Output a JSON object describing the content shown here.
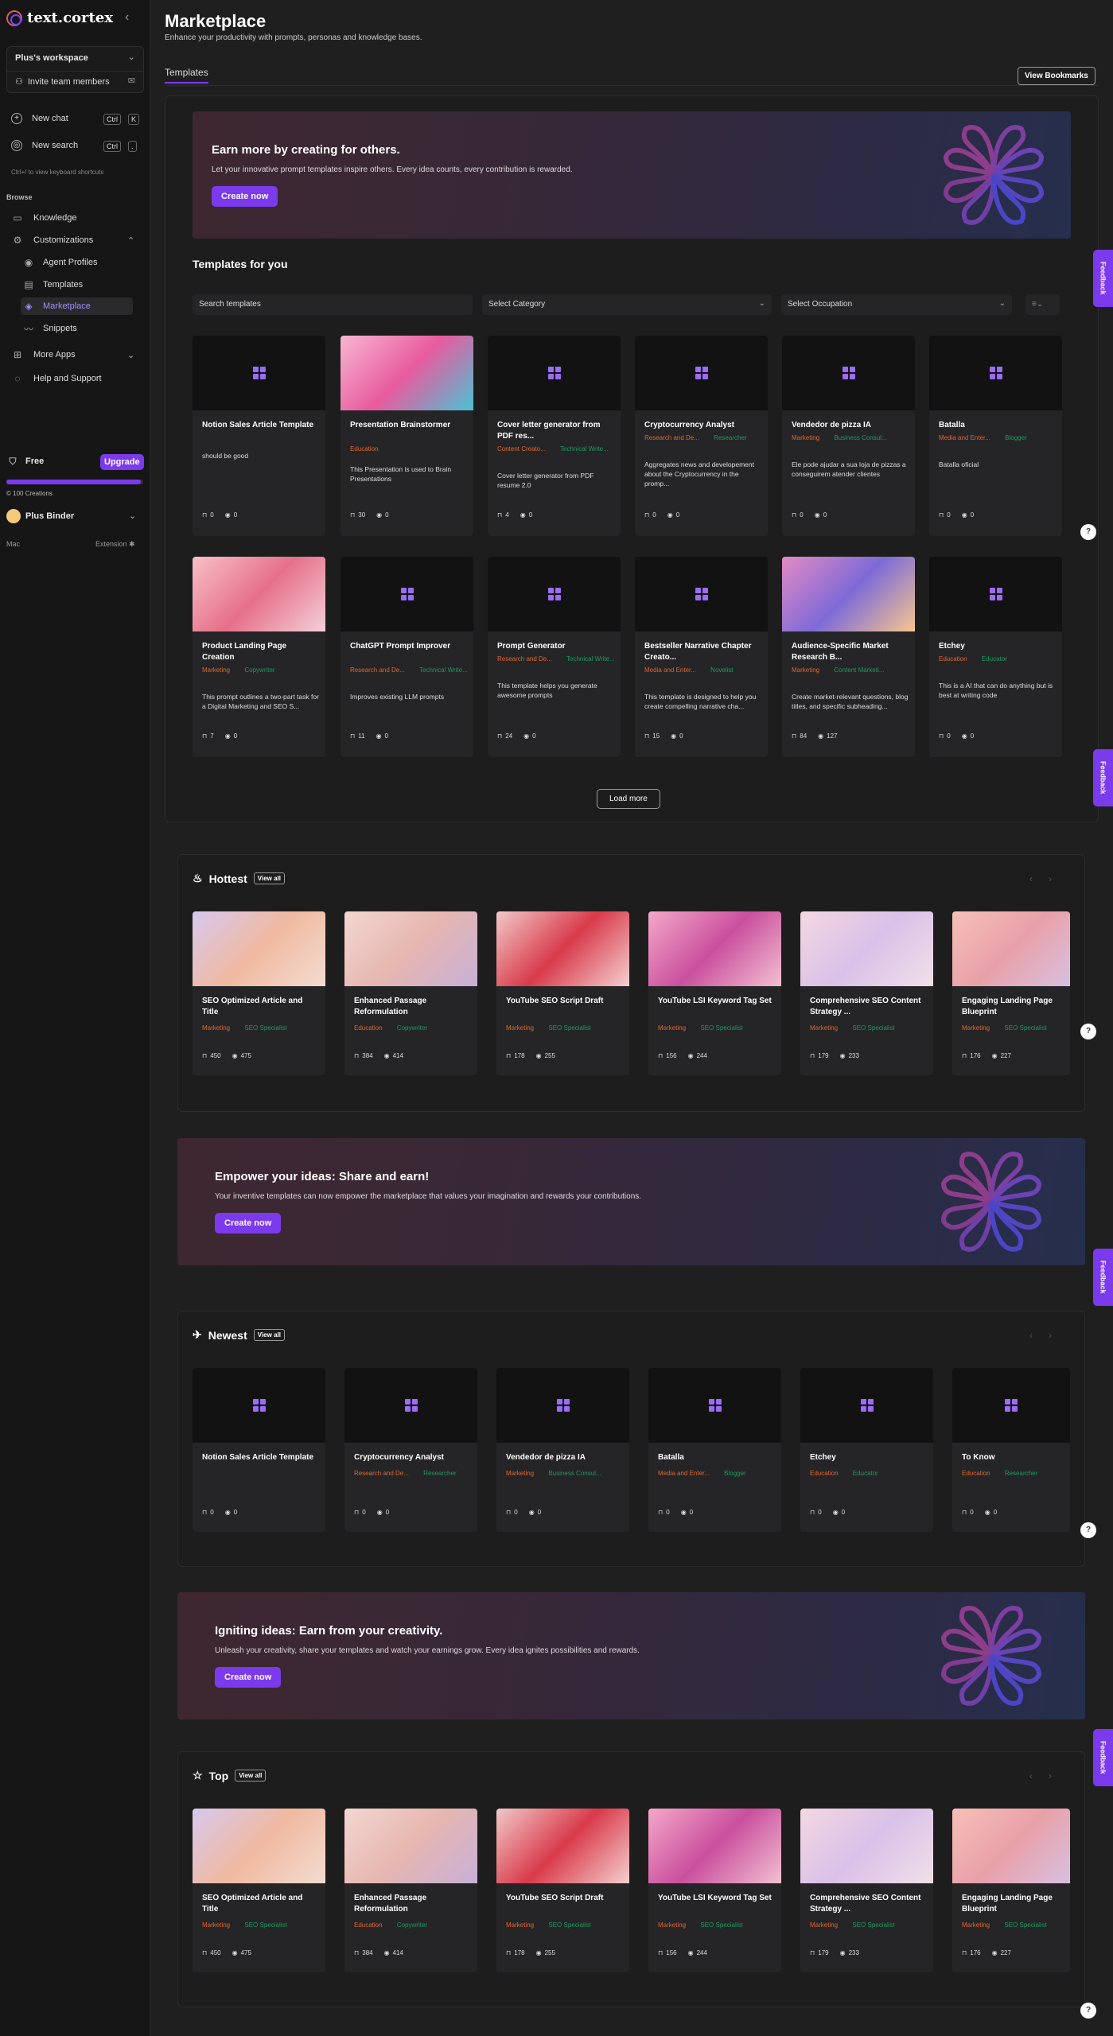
{
  "sidebar": {
    "logo": "text.cortex",
    "workspace": "Plus's workspace",
    "invite": "Invite team members",
    "new_chat": "New chat",
    "new_chat_kbd1": "Ctrl",
    "new_chat_kbd2": "K",
    "new_search": "New search",
    "new_search_kbd1": "Ctrl",
    "new_search_kbd2": ".",
    "shortcut_hint": "Ctrl+/ to view keyboard shortcuts",
    "browse": "Browse",
    "knowledge": "Knowledge",
    "customizations": "Customizations",
    "sub": [
      "Agent Profiles",
      "Templates",
      "Marketplace",
      "Snippets"
    ],
    "more_apps": "More Apps",
    "help": "Help and Support",
    "plan": "Free",
    "upgrade": "Upgrade",
    "credits_progress": 0.98,
    "credits": "100 Creations",
    "user": "Plus Binder",
    "mac": "Mac",
    "extension": "Extension"
  },
  "header": {
    "title": "Marketplace",
    "subtitle": "Enhance your productivity with prompts, personas and knowledge bases.",
    "tab": "Templates",
    "bookmarks": "View Bookmarks"
  },
  "banner1": {
    "title": "Earn more by creating for others.",
    "text": "Let your innovative prompt templates inspire others. Every idea counts, every contribution is rewarded.",
    "button": "Create now"
  },
  "templates_for_you": {
    "title": "Templates for you",
    "search_placeholder": "Search templates",
    "category": "Select Category",
    "occupation": "Select Occupation",
    "load_more": "Load more",
    "cards": [
      {
        "title": "Notion Sales Article Template",
        "tags": [],
        "desc": "should be good",
        "saves": "0",
        "views": "0"
      },
      {
        "title": "Presentation Brainstormer",
        "tags": [
          [
            "Education",
            "o"
          ]
        ],
        "desc": "This Presentation is used to Brain Presentations",
        "saves": "30",
        "views": "0"
      },
      {
        "title": "Cover letter generator from PDF res...",
        "tags": [
          [
            "Content Creato...",
            "o"
          ],
          [
            "Technical Write...",
            "g"
          ]
        ],
        "desc": "Cover letter generator from PDF resume 2.0",
        "saves": "4",
        "views": "0"
      },
      {
        "title": "Cryptocurrency Analyst",
        "tags": [
          [
            "Research and De...",
            "o"
          ],
          [
            "Researcher",
            "g"
          ]
        ],
        "desc": "Aggregates news and developement about the Cryptocurrency in the promp...",
        "saves": "0",
        "views": "0"
      },
      {
        "title": "Vendedor de pizza IA",
        "tags": [
          [
            "Marketing",
            "o"
          ],
          [
            "Business Consul...",
            "g"
          ]
        ],
        "desc": "Ele pode ajudar a sua loja de pizzas a conseguirem atender clientes",
        "saves": "0",
        "views": "0"
      },
      {
        "title": "Batalla",
        "tags": [
          [
            "Media and Enter...",
            "o"
          ],
          [
            "Blogger",
            "g"
          ]
        ],
        "desc": "Batalla oficial",
        "saves": "0",
        "views": "0"
      },
      {
        "title": "Product Landing Page Creation",
        "tags": [
          [
            "Marketing",
            "o"
          ],
          [
            "Copywriter",
            "g"
          ]
        ],
        "desc": "This prompt outlines a two-part task for a Digital Marketing and SEO S...",
        "saves": "7",
        "views": "0"
      },
      {
        "title": "ChatGPT Prompt Improver",
        "tags": [
          [
            "Research and De...",
            "o"
          ],
          [
            "Technical Write...",
            "g"
          ]
        ],
        "desc": "Improves existing LLM prompts",
        "saves": "11",
        "views": "0"
      },
      {
        "title": "Prompt Generator",
        "tags": [
          [
            "Research and De...",
            "o"
          ],
          [
            "Technical Write...",
            "g"
          ]
        ],
        "desc": "This template helps you generate awesome prompts",
        "saves": "24",
        "views": "0"
      },
      {
        "title": "Bestseller Narrative Chapter Creato...",
        "tags": [
          [
            "Media and Enter...",
            "o"
          ],
          [
            "Novelist",
            "g"
          ]
        ],
        "desc": "This template is designed to help you create compelling narrative cha...",
        "saves": "15",
        "views": "0"
      },
      {
        "title": "Audience-Specific Market Research B...",
        "tags": [
          [
            "Marketing",
            "o"
          ],
          [
            "Content Marketi...",
            "g"
          ]
        ],
        "desc": "Create market-relevant questions, blog titles, and specific subheading...",
        "saves": "84",
        "views": "127"
      },
      {
        "title": "Etchey",
        "tags": [
          [
            "Education",
            "o"
          ],
          [
            "Educator",
            "g"
          ]
        ],
        "desc": "This is a AI that can do anything but is best at writing code",
        "saves": "0",
        "views": "0"
      }
    ]
  },
  "hottest": {
    "title": "Hottest",
    "view_all": "View all",
    "cards": [
      {
        "title": "SEO Optimized Article and Title",
        "tags": [
          [
            "Marketing",
            "o"
          ],
          [
            "SEO Specialist",
            "g"
          ]
        ],
        "saves": "450",
        "views": "475"
      },
      {
        "title": "Enhanced Passage Reformulation",
        "tags": [
          [
            "Education",
            "o"
          ],
          [
            "Copywriter",
            "g"
          ]
        ],
        "saves": "384",
        "views": "414"
      },
      {
        "title": "YouTube SEO Script Draft",
        "tags": [
          [
            "Marketing",
            "o"
          ],
          [
            "SEO Specialist",
            "g"
          ]
        ],
        "saves": "178",
        "views": "255"
      },
      {
        "title": "YouTube LSI Keyword Tag Set",
        "tags": [
          [
            "Marketing",
            "o"
          ],
          [
            "SEO Specialist",
            "g"
          ]
        ],
        "saves": "156",
        "views": "244"
      },
      {
        "title": "Comprehensive SEO Content Strategy ...",
        "tags": [
          [
            "Marketing",
            "o"
          ],
          [
            "SEO Specialist",
            "g"
          ]
        ],
        "saves": "179",
        "views": "233"
      },
      {
        "title": "Engaging Landing Page Blueprint",
        "tags": [
          [
            "Marketing",
            "o"
          ],
          [
            "SEO Specialist",
            "g"
          ]
        ],
        "saves": "176",
        "views": "227"
      }
    ]
  },
  "banner2": {
    "title": "Empower your ideas: Share and earn!",
    "text": "Your inventive templates can now empower the marketplace that values your imagination and rewards your contributions.",
    "button": "Create now"
  },
  "newest": {
    "title": "Newest",
    "view_all": "View all",
    "cards": [
      {
        "title": "Notion Sales Article Template",
        "tags": [],
        "saves": "0",
        "views": "0"
      },
      {
        "title": "Cryptocurrency Analyst",
        "tags": [
          [
            "Research and De...",
            "o"
          ],
          [
            "Researcher",
            "g"
          ]
        ],
        "saves": "0",
        "views": "0"
      },
      {
        "title": "Vendedor de pizza IA",
        "tags": [
          [
            "Marketing",
            "o"
          ],
          [
            "Business Consul...",
            "g"
          ]
        ],
        "saves": "0",
        "views": "0"
      },
      {
        "title": "Batalla",
        "tags": [
          [
            "Media and Enter...",
            "o"
          ],
          [
            "Blogger",
            "g"
          ]
        ],
        "saves": "0",
        "views": "0"
      },
      {
        "title": "Etchey",
        "tags": [
          [
            "Education",
            "o"
          ],
          [
            "Educator",
            "g"
          ]
        ],
        "saves": "0",
        "views": "0"
      },
      {
        "title": "To Know",
        "tags": [
          [
            "Education",
            "o"
          ],
          [
            "Researcher",
            "g"
          ]
        ],
        "saves": "0",
        "views": "0"
      }
    ]
  },
  "banner3": {
    "title": "Igniting ideas: Earn from your creativity.",
    "text": "Unleash your creativity, share your templates and watch your earnings grow. Every idea ignites possibilities and rewards.",
    "button": "Create now"
  },
  "top": {
    "title": "Top",
    "view_all": "View all",
    "cards": [
      {
        "title": "SEO Optimized Article and Title",
        "tags": [
          [
            "Marketing",
            "o"
          ],
          [
            "SEO Specialist",
            "g"
          ]
        ],
        "saves": "450",
        "views": "475"
      },
      {
        "title": "Enhanced Passage Reformulation",
        "tags": [
          [
            "Education",
            "o"
          ],
          [
            "Copywriter",
            "g"
          ]
        ],
        "saves": "384",
        "views": "414"
      },
      {
        "title": "YouTube SEO Script Draft",
        "tags": [
          [
            "Marketing",
            "o"
          ],
          [
            "SEO Specialist",
            "g"
          ]
        ],
        "saves": "178",
        "views": "255"
      },
      {
        "title": "YouTube LSI Keyword Tag Set",
        "tags": [
          [
            "Marketing",
            "o"
          ],
          [
            "SEO Specialist",
            "g"
          ]
        ],
        "saves": "156",
        "views": "244"
      },
      {
        "title": "Comprehensive SEO Content Strategy ...",
        "tags": [
          [
            "Marketing",
            "o"
          ],
          [
            "SEO Specialist",
            "g"
          ]
        ],
        "saves": "179",
        "views": "233"
      },
      {
        "title": "Engaging Landing Page Blueprint",
        "tags": [
          [
            "Marketing",
            "o"
          ],
          [
            "SEO Specialist",
            "g"
          ]
        ],
        "saves": "176",
        "views": "227"
      }
    ]
  },
  "feedback": "Feedback",
  "help_icon": "?",
  "colors": {
    "accent": "#7c3aed",
    "tag_orange": "#e2652a",
    "tag_green": "#1c9a62"
  }
}
